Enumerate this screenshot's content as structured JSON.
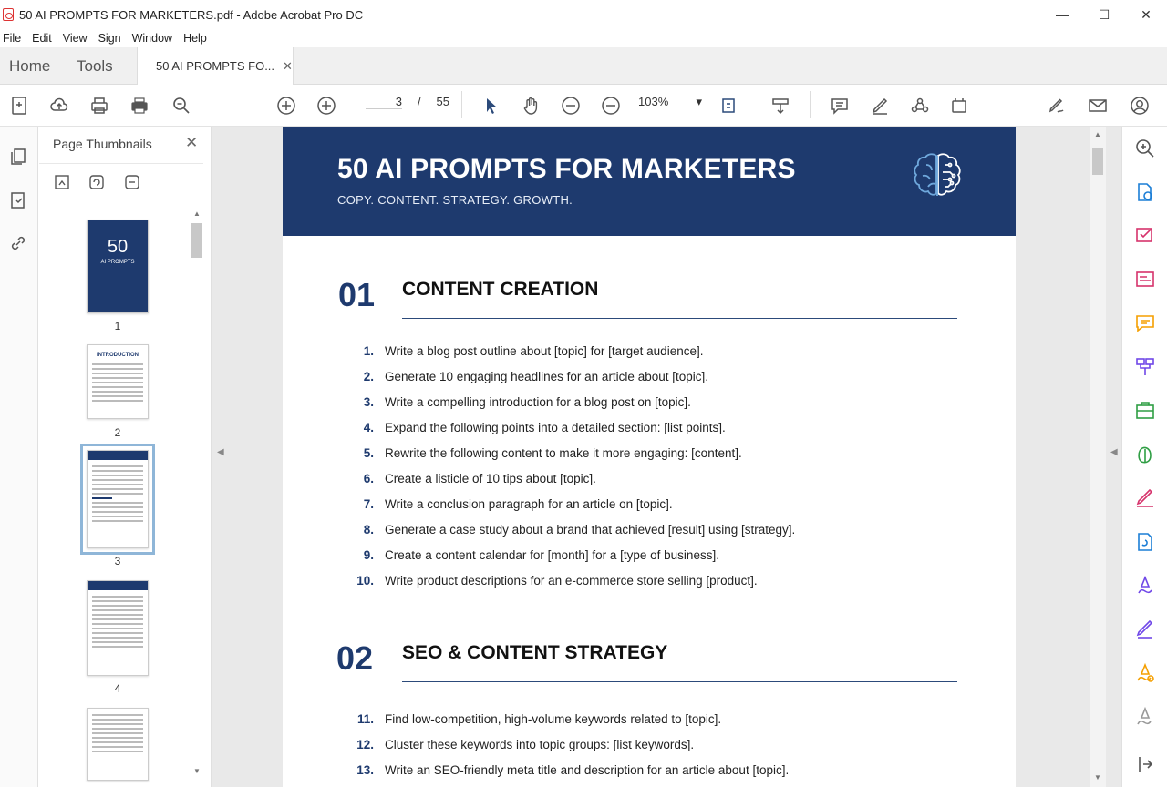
{
  "window": {
    "title": "50 AI PROMPTS FOR MARKETERS.pdf - Adobe Acrobat Pro DC",
    "controls": [
      "—",
      "☐",
      "✕"
    ]
  },
  "menu": [
    "File",
    "Edit",
    "View",
    "Sign",
    "Window",
    "Help"
  ],
  "tabs": {
    "home": "Home",
    "tools": "Tools",
    "doc_tab": "50 AI PROMPTS FO...",
    "doc_tab_close": "✕"
  },
  "toolbar": {
    "current_page": "3",
    "page_separator": "/",
    "total_pages": "55",
    "zoom": "103%",
    "zoom_caret": "▾"
  },
  "thumbnails": {
    "title": "Page Thumbnails",
    "close": "✕",
    "pages": [
      {
        "label": "1",
        "cover_big": "50",
        "cover_small": "AI PROMPTS"
      },
      {
        "label": "2",
        "heading": "INTRODUCTION"
      },
      {
        "label": "3"
      },
      {
        "label": "4"
      }
    ]
  },
  "document": {
    "banner_title": "50 AI PROMPTS FOR MARKETERS",
    "banner_subtitle": "COPY. CONTENT. STRATEGY. GROWTH.",
    "sections": [
      {
        "number": "01",
        "title": "CONTENT CREATION",
        "items": [
          {
            "n": "1.",
            "text": "Write a blog post outline about [topic] for [target audience]."
          },
          {
            "n": "2.",
            "text": "Generate 10 engaging headlines for an article about [topic]."
          },
          {
            "n": "3.",
            "text": "Write a compelling introduction for a blog post on [topic]."
          },
          {
            "n": "4.",
            "text": "Expand the following points into a detailed section: [list points]."
          },
          {
            "n": "5.",
            "text": "Rewrite the following content to make it more engaging: [content]."
          },
          {
            "n": "6.",
            "text": "Create a listicle of 10 tips about [topic]."
          },
          {
            "n": "7.",
            "text": "Write a conclusion paragraph for an article on [topic]."
          },
          {
            "n": "8.",
            "text": "Generate a case study about a brand that achieved [result] using [strategy]."
          },
          {
            "n": "9.",
            "text": "Create a content calendar for [month] for a [type of business]."
          },
          {
            "n": "10.",
            "text": "Write product descriptions for an e-commerce store selling [product]."
          }
        ]
      },
      {
        "number": "02",
        "title": "SEO & CONTENT STRATEGY",
        "items": [
          {
            "n": "11.",
            "text": "Find low-competition, high-volume keywords related to [topic]."
          },
          {
            "n": "12.",
            "text": "Cluster these keywords into topic groups: [list keywords]."
          },
          {
            "n": "13.",
            "text": "Write an SEO-friendly meta title and description for an article about [topic]."
          }
        ]
      }
    ]
  },
  "colors": {
    "banner_navy": "#1e3a6e",
    "accent_pink": "#d6336c",
    "accent_green": "#2f9e44",
    "accent_blue": "#1c7ed6",
    "accent_purple": "#7048e8",
    "accent_yellow": "#f59f00"
  }
}
